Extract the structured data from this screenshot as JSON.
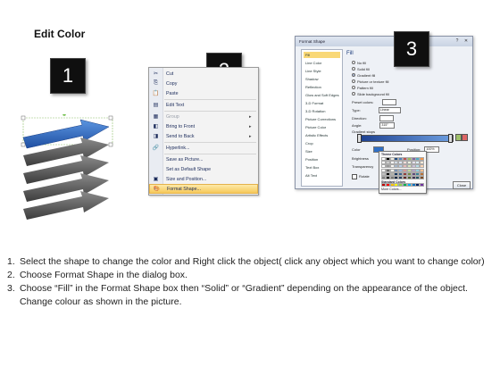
{
  "title": "Edit Color",
  "steps": {
    "one": "1",
    "two": "2",
    "three": "3"
  },
  "context_menu": {
    "items": [
      {
        "icon": "✂",
        "label": "Cut",
        "submenu": false,
        "disabled": false
      },
      {
        "icon": "⎘",
        "label": "Copy",
        "submenu": false,
        "disabled": false
      },
      {
        "icon": "📋",
        "label": "Paste",
        "submenu": false,
        "disabled": false
      },
      {
        "icon": "▤",
        "label": "Edit Text",
        "submenu": false,
        "disabled": false
      },
      {
        "icon": "▦",
        "label": "Group",
        "submenu": true,
        "disabled": true
      },
      {
        "icon": "◧",
        "label": "Bring to Front",
        "submenu": true,
        "disabled": false
      },
      {
        "icon": "◨",
        "label": "Send to Back",
        "submenu": true,
        "disabled": false
      },
      {
        "icon": "🔗",
        "label": "Hyperlink...",
        "submenu": false,
        "disabled": false
      },
      {
        "icon": "",
        "label": "Save as Picture...",
        "submenu": false,
        "disabled": false
      },
      {
        "icon": "",
        "label": "Set as Default Shape",
        "submenu": false,
        "disabled": false
      },
      {
        "icon": "▣",
        "label": "Size and Position...",
        "submenu": false,
        "disabled": false
      },
      {
        "icon": "🎨",
        "label": "Format Shape...",
        "submenu": false,
        "disabled": false
      }
    ]
  },
  "dialog": {
    "title": "Format Shape",
    "categories": [
      "Fill",
      "Line Color",
      "Line Style",
      "Shadow",
      "Reflection",
      "Glow and Soft Edges",
      "3-D Format",
      "3-D Rotation",
      "Picture Corrections",
      "Picture Color",
      "Artistic Effects",
      "Crop",
      "Size",
      "Position",
      "Text Box",
      "Alt Text"
    ],
    "fill_heading": "Fill",
    "fill_options": [
      "No fill",
      "Solid fill",
      "Gradient fill",
      "Picture or texture fill",
      "Pattern fill",
      "Slide background fill"
    ],
    "preset_colors_label": "Preset colors:",
    "type_label": "Type:",
    "type_value": "Linear",
    "direction_label": "Direction:",
    "angle_label": "Angle:",
    "angle_value": "315°",
    "gradient_stops_label": "Gradient stops",
    "color_label": "Color",
    "position_label": "Position:",
    "position_value": "100%",
    "brightness_label": "Brightness",
    "transparency_label": "Transparency",
    "rotate_label": "Rotate",
    "theme_colors_label": "Theme Colors",
    "standard_colors_label": "Standard Colors",
    "more_colors_label": "More Colors...",
    "close_label": "Close"
  },
  "instructions": [
    {
      "num": "1.",
      "text": "Select the shape to change the color and Right click the object( click any object which you want to change color)"
    },
    {
      "num": "2.",
      "text": "Choose Format Shape in the dialog box."
    },
    {
      "num": "3.",
      "text": "Choose “Fill” in the Format Shape box then “Solid” or “Gradient” depending on the appearance of the object. Change colour as shown in the picture."
    }
  ],
  "colors": {
    "accent_blue": "#2f6fc6",
    "arrow_gray": "#4a4a4a",
    "highlight": "#f7c95a"
  }
}
